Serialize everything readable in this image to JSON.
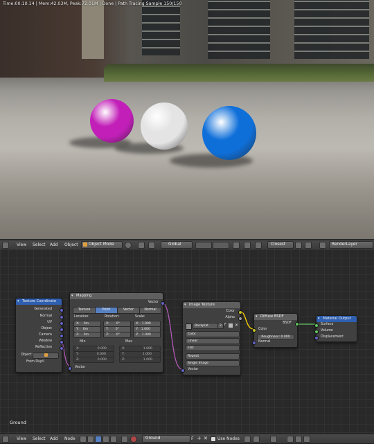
{
  "viewport": {
    "status": "Time:00:10.14 | Mem:42.03M, Peak:72.01M | Done | Path Tracing Sample 150/150",
    "spheres": [
      {
        "name": "magenta",
        "color": "#c21fb8"
      },
      {
        "name": "white",
        "color": "#e4e4e4"
      },
      {
        "name": "blue",
        "color": "#0f6fd9"
      }
    ]
  },
  "view_header": {
    "menus": [
      "View",
      "Select",
      "Add",
      "Object"
    ],
    "mode": "Object Mode",
    "pivot": "Global",
    "snap": "Closest",
    "layer": "RenderLayer"
  },
  "nodes": {
    "texcoord": {
      "title": "Texture Coordinate",
      "outputs": [
        "Generated",
        "Normal",
        "UV",
        "Object",
        "Camera",
        "Window",
        "Reflection"
      ],
      "object_label": "Object:",
      "dupli": "From Dupli"
    },
    "mapping": {
      "title": "Mapping",
      "output": "Vector",
      "tabs": [
        "Texture",
        "Point",
        "Vector",
        "Normal"
      ],
      "active_tab": "Point",
      "location_label": "Location:",
      "rotation_label": "Rotation:",
      "scale_label": "Scale:",
      "rows": [
        {
          "axis": "X:",
          "loc": "0m",
          "rot": "0°",
          "scale": "1.000"
        },
        {
          "axis": "Y:",
          "loc": "0m",
          "rot": "0°",
          "scale": "1.000"
        },
        {
          "axis": "Z:",
          "loc": "0m",
          "rot": "0°",
          "scale": "1.000"
        }
      ],
      "min_label": "Min",
      "max_label": "Max",
      "minmax": [
        {
          "axis": "X:",
          "min": "0.000",
          "max": "1.000"
        },
        {
          "axis": "Y:",
          "min": "0.000",
          "max": "1.000"
        },
        {
          "axis": "Z:",
          "min": "0.000",
          "max": "1.000"
        }
      ],
      "input": "Vector"
    },
    "image": {
      "title": "Image Texture",
      "outputs": [
        "Color",
        "Alpha"
      ],
      "image_name": "Backplat",
      "users": "2",
      "fake": "F",
      "options": [
        "Color",
        "Linear",
        "Flat",
        "Repeat",
        "Single Image"
      ],
      "input": "Vector"
    },
    "diffuse": {
      "title": "Diffuse BSDF",
      "output": "BSDF",
      "inputs": [
        "Color",
        "Normal"
      ],
      "roughness": "Roughness: 0.000"
    },
    "output": {
      "title": "Material Output",
      "inputs": [
        "Surface",
        "Volume",
        "Displacement"
      ]
    }
  },
  "node_header": {
    "menus": [
      "View",
      "Select",
      "Add",
      "Node"
    ],
    "material": "Ground",
    "fake": "F",
    "use_nodes": "Use Nodes"
  },
  "material_label": "Ground",
  "colors": {
    "texcoord_header": "#2f5fb0",
    "mapping_header": "#5f5f5f",
    "image_header": "#5f5f5f",
    "diffuse_header": "#5f5f5f",
    "output_header": "#2f5fb0",
    "link_color": "#b25ab8",
    "tab_active": "#5680c2"
  }
}
